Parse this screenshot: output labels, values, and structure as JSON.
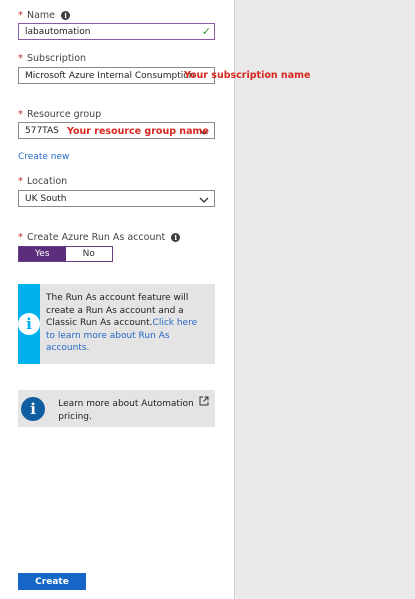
{
  "form": {
    "name": {
      "label": "Name",
      "value": "labautomation"
    },
    "subscription": {
      "label": "Subscription",
      "value": "Microsoft Azure Internal Consumption",
      "annotation": "Your subscription name"
    },
    "resource_group": {
      "label": "Resource group",
      "value": "577TAS",
      "annotation": "Your resource group name",
      "create_new": "Create new"
    },
    "location": {
      "label": "Location",
      "value": "UK South"
    },
    "run_as": {
      "label": "Create Azure Run As account",
      "yes": "Yes",
      "no": "No",
      "selected": "Yes"
    },
    "required_marker": "*"
  },
  "info_run_as": {
    "text": "The Run As account feature will create a Run As account and a Classic Run As account.",
    "link": "Click here to learn more about Run As accounts."
  },
  "info_pricing": {
    "text": "Learn more about Automation pricing."
  },
  "footer": {
    "create_label": "Create"
  },
  "colors": {
    "accent_purple": "#5b2d7a",
    "primary_blue": "#1566c6",
    "info_blue": "#00b0ec",
    "info_dark_blue": "#0f5e9f",
    "annotation_red": "#d7261e"
  },
  "icons": [
    "info-icon",
    "checkmark-icon",
    "chevron-down-icon",
    "external-link-icon"
  ]
}
